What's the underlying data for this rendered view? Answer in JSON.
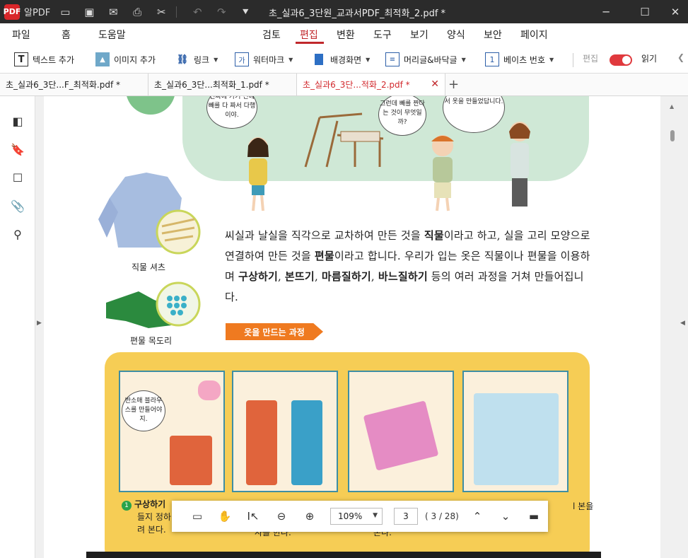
{
  "app": {
    "name": "알PDF",
    "logo": "PDF"
  },
  "window": {
    "title": "초_실과6_3단원_교과서PDF_최적화_2.pdf *"
  },
  "menu": [
    "파일",
    "홈",
    "도움말",
    "검토",
    "편집",
    "변환",
    "도구",
    "보기",
    "양식",
    "보안",
    "페이지"
  ],
  "menu_active": "편집",
  "toolbar": {
    "add_text": "텍스트 추가",
    "add_image": "이미지 추가",
    "link": "링크",
    "watermark": "워터마크",
    "background": "배경화면",
    "header_footer": "머리글&바닥글",
    "bates": "베이츠 번호",
    "edit_mode": "편집",
    "read_mode": "읽기"
  },
  "tabs": [
    {
      "label": "초_실과6_3단...F_최적화.pdf *"
    },
    {
      "label": "초_실과6_3단...최적화_1.pdf *"
    },
    {
      "label": "초_실과6_3단...적화_2.pdf *"
    }
  ],
  "document": {
    "bubble_1": "진짜에 가기 전에 빼를 다 짜서 다행이야.",
    "bubble_2": "그런데 빼를 짠다는 것이 무엇일까?",
    "bubble_3": "빼틀로 직접 옷감을 짜서 옷을 만들었답니다.",
    "caption_shirt": "직물 셔츠",
    "caption_scarf": "편물 목도리",
    "paragraph": {
      "p1": "씨실과 날실을 직각으로 교차하여 만든 것을 ",
      "b1": "직물",
      "p2": "이라고 하고, 실을 고리 모양으로 연결하여 만든 것을 ",
      "b2": "편물",
      "p3": "이라고 합니다. 우리가 입는 옷은 직물이나 편물을 이용하며 ",
      "b3": "구상하기",
      "p4": ", ",
      "b4": "본뜨기",
      "p5": ", ",
      "b5": "마름질하기",
      "p6": ", ",
      "b6": "바느질하기",
      "p7": " 등의 여러 과정을 거쳐 만들어집니다."
    },
    "section_label": "옷을 만드는 과정",
    "panel_bubble": "반소매 블라우스를 만들어야지.",
    "step_num": "1",
    "step_title": "구상하기",
    "step_line2": "들지 정하",
    "step_line3": "려 본다.",
    "step_right": "l 본을",
    "step_cut_1": "사를 한다.",
    "step_cut_2": "본다."
  },
  "viewer_bar": {
    "zoom": "109%",
    "page_input": "3",
    "page_total": "( 3 / 28)"
  },
  "colors": {
    "accent": "#c0282c",
    "titlebar": "#2b2b2b",
    "section_orange": "#ef7a20",
    "panel_yellow": "#f6cd55",
    "scene_green": "#cfe8d6"
  }
}
